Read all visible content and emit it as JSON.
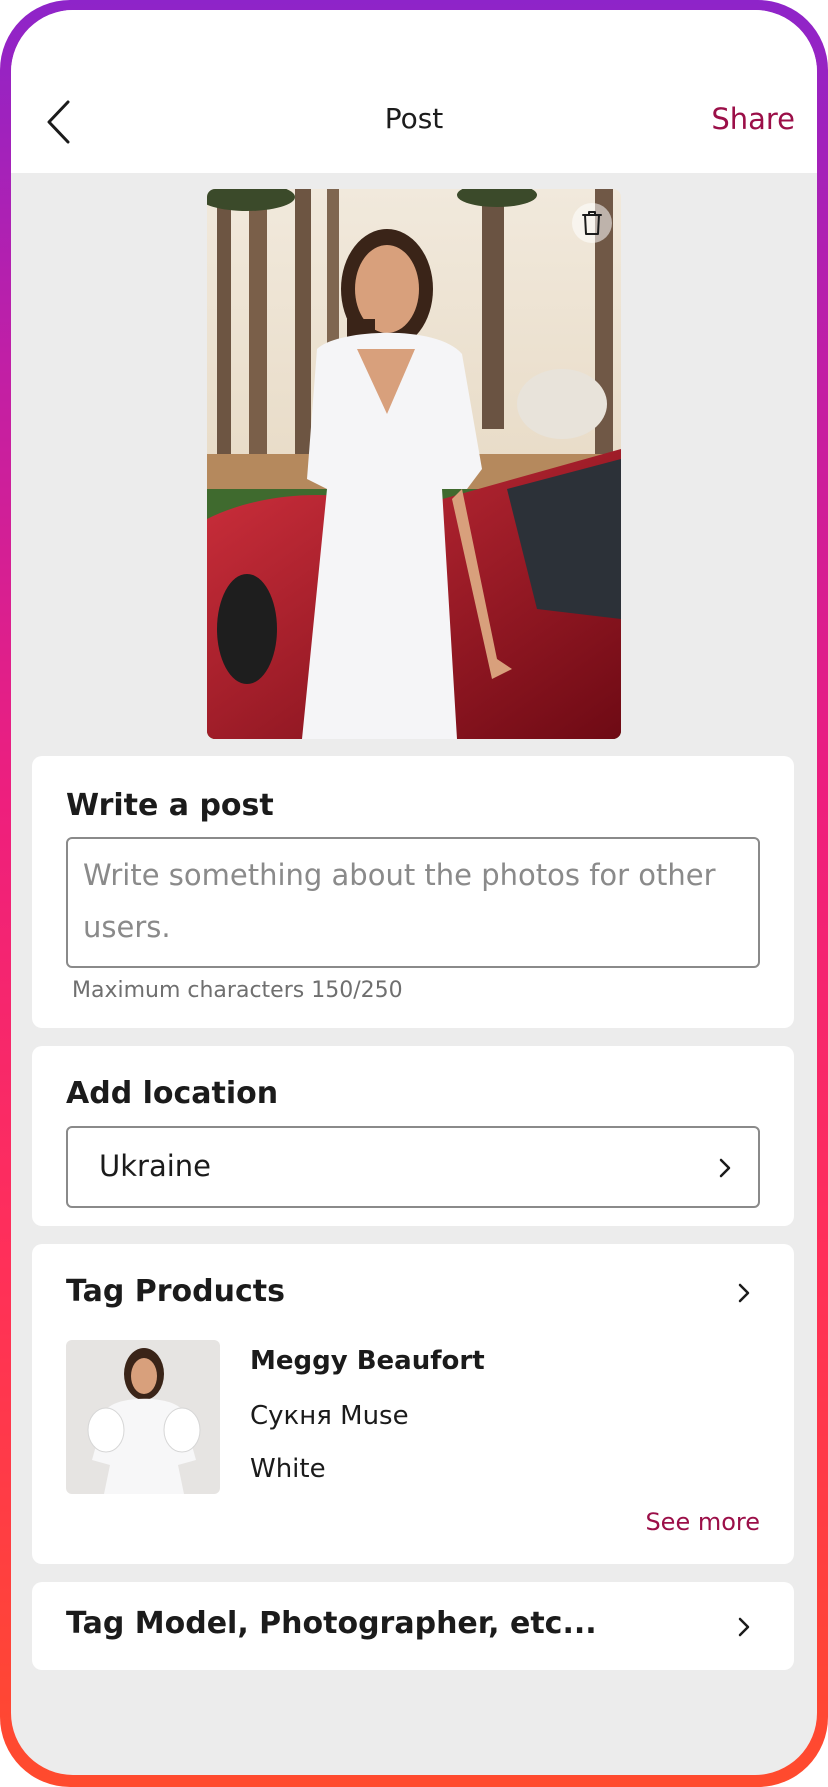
{
  "colors": {
    "accent": "#9b0f48",
    "background": "#ececec",
    "card": "#ffffff"
  },
  "header": {
    "title": "Post",
    "share_label": "Share",
    "back_icon": "chevron-left-icon"
  },
  "photo": {
    "delete_icon": "trash-icon"
  },
  "post": {
    "title": "Write a post",
    "placeholder": "Write something about the photos for other users.",
    "value": "",
    "hint": "Maximum characters 150/250"
  },
  "location": {
    "title": "Add location",
    "value": "Ukraine"
  },
  "tag_products": {
    "title": "Tag Products",
    "product": {
      "brand": "Meggy Beaufort",
      "name": "Сукня Muse",
      "color": "White"
    },
    "see_more": "See more"
  },
  "tag_people": {
    "title": "Tag Model, Photographer,  etc..."
  }
}
